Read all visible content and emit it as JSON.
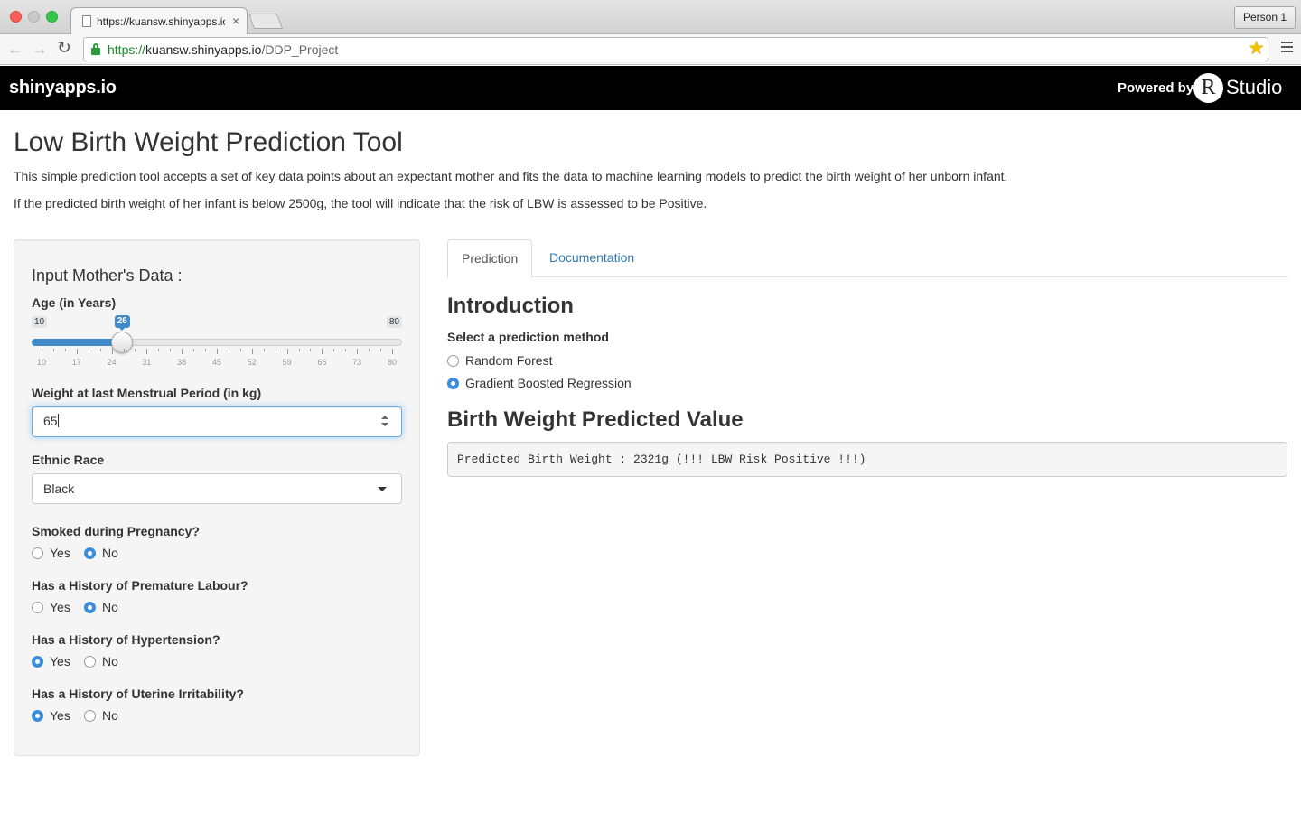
{
  "browser": {
    "tab_title": "https://kuansw.shinyapps.io",
    "tab_close": "×",
    "profile": "Person 1",
    "url_scheme": "https://",
    "url_host": "kuansw.shinyapps.io",
    "url_path": "/DDP_Project",
    "icons": {
      "back": "←",
      "forward": "→",
      "reload": "↻",
      "star": "★"
    }
  },
  "appbar": {
    "brand": "shinyapps.io",
    "powered_by": "Powered by",
    "r_logo": "R",
    "studio": "Studio"
  },
  "page": {
    "title": "Low Birth Weight Prediction Tool",
    "intro1": "This simple prediction tool accepts a set of key data points about an expectant mother and fits the data to machine learning models to predict the birth weight of her unborn infant.",
    "intro2": "If the predicted birth weight of her infant is below 2500g, the tool will indicate that the risk of LBW is assessed to be Positive."
  },
  "sidebar": {
    "heading": "Input Mother's Data :",
    "age": {
      "label": "Age (in Years)",
      "min": "10",
      "max": "80",
      "value": "26",
      "value_fraction": 0.2286,
      "ticks": [
        "10",
        "17",
        "24",
        "31",
        "38",
        "45",
        "52",
        "59",
        "66",
        "73",
        "80"
      ]
    },
    "weight": {
      "label": "Weight at last Menstrual Period (in kg)",
      "value": "65"
    },
    "race": {
      "label": "Ethnic Race",
      "selected": "Black"
    },
    "smoked": {
      "label": "Smoked during Pregnancy?",
      "yes": "Yes",
      "no": "No",
      "selected": "No"
    },
    "premature": {
      "label": "Has a History of Premature Labour?",
      "yes": "Yes",
      "no": "No",
      "selected": "No"
    },
    "hypertension": {
      "label": "Has a History of Hypertension?",
      "yes": "Yes",
      "no": "No",
      "selected": "Yes"
    },
    "uterine": {
      "label": "Has a History of Uterine Irritability?",
      "yes": "Yes",
      "no": "No",
      "selected": "Yes"
    }
  },
  "main": {
    "tabs": [
      {
        "label": "Prediction",
        "active": true
      },
      {
        "label": "Documentation",
        "active": false
      }
    ],
    "intro_heading": "Introduction",
    "method_label": "Select a prediction method",
    "methods": [
      {
        "label": "Random Forest",
        "selected": false
      },
      {
        "label": "Gradient Boosted Regression",
        "selected": true
      }
    ],
    "result_heading": "Birth Weight Predicted Value",
    "result_text": "Predicted Birth Weight : 2321g (!!! LBW Risk Positive !!!)"
  },
  "colors": {
    "accent": "#428bca",
    "radio_checked": "#3b8ede",
    "link": "#337ab7"
  }
}
